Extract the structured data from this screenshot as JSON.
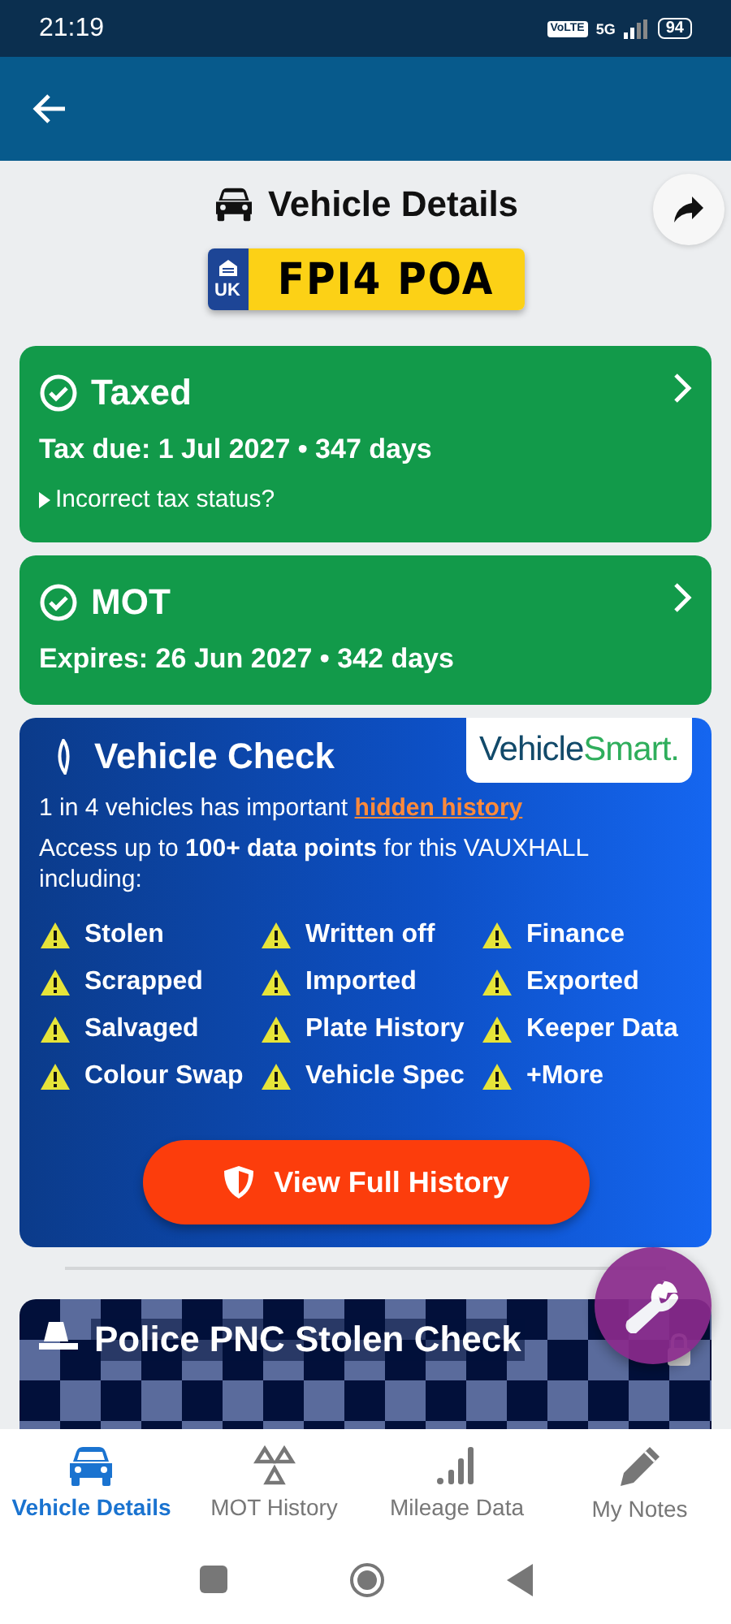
{
  "status_bar": {
    "time": "21:19",
    "volte": "VoLTE",
    "network": "5G",
    "battery": "94"
  },
  "header": {
    "title": "Vehicle Details",
    "plate": {
      "country": "UK",
      "registration": "FPI4 POA"
    }
  },
  "status_cards": [
    {
      "title": "Taxed",
      "ok": true,
      "detail": "Tax due: 1 Jul 2027 • 347 days",
      "link": "Incorrect tax status?"
    },
    {
      "title": "MOT",
      "ok": true,
      "detail": "Expires: 26 Jun 2027 • 342 days"
    }
  ],
  "vehicle_check": {
    "title": "Vehicle Check",
    "logo": {
      "first": "Vehicle",
      "second": "Smart."
    },
    "intro": "1 in 4 vehicles has important ",
    "intro_link": "hidden history",
    "description": "Access up to **100+ data points** for this VAUXHALL including:",
    "items": [
      "Stolen",
      "Written off",
      "Finance",
      "Scrapped",
      "Imported",
      "Exported",
      "Salvaged",
      "Plate History",
      "Keeper Data",
      "Colour Swap",
      "Vehicle Spec",
      "+More"
    ],
    "button": "View Full History"
  },
  "police_check": {
    "title": "Police PNC Stolen Check",
    "locked": true
  },
  "bottom_nav": [
    {
      "label": "Vehicle Details",
      "selected": true
    },
    {
      "label": "MOT History",
      "selected": false
    },
    {
      "label": "Mileage Data",
      "selected": false
    },
    {
      "label": "My Notes",
      "selected": false
    }
  ]
}
